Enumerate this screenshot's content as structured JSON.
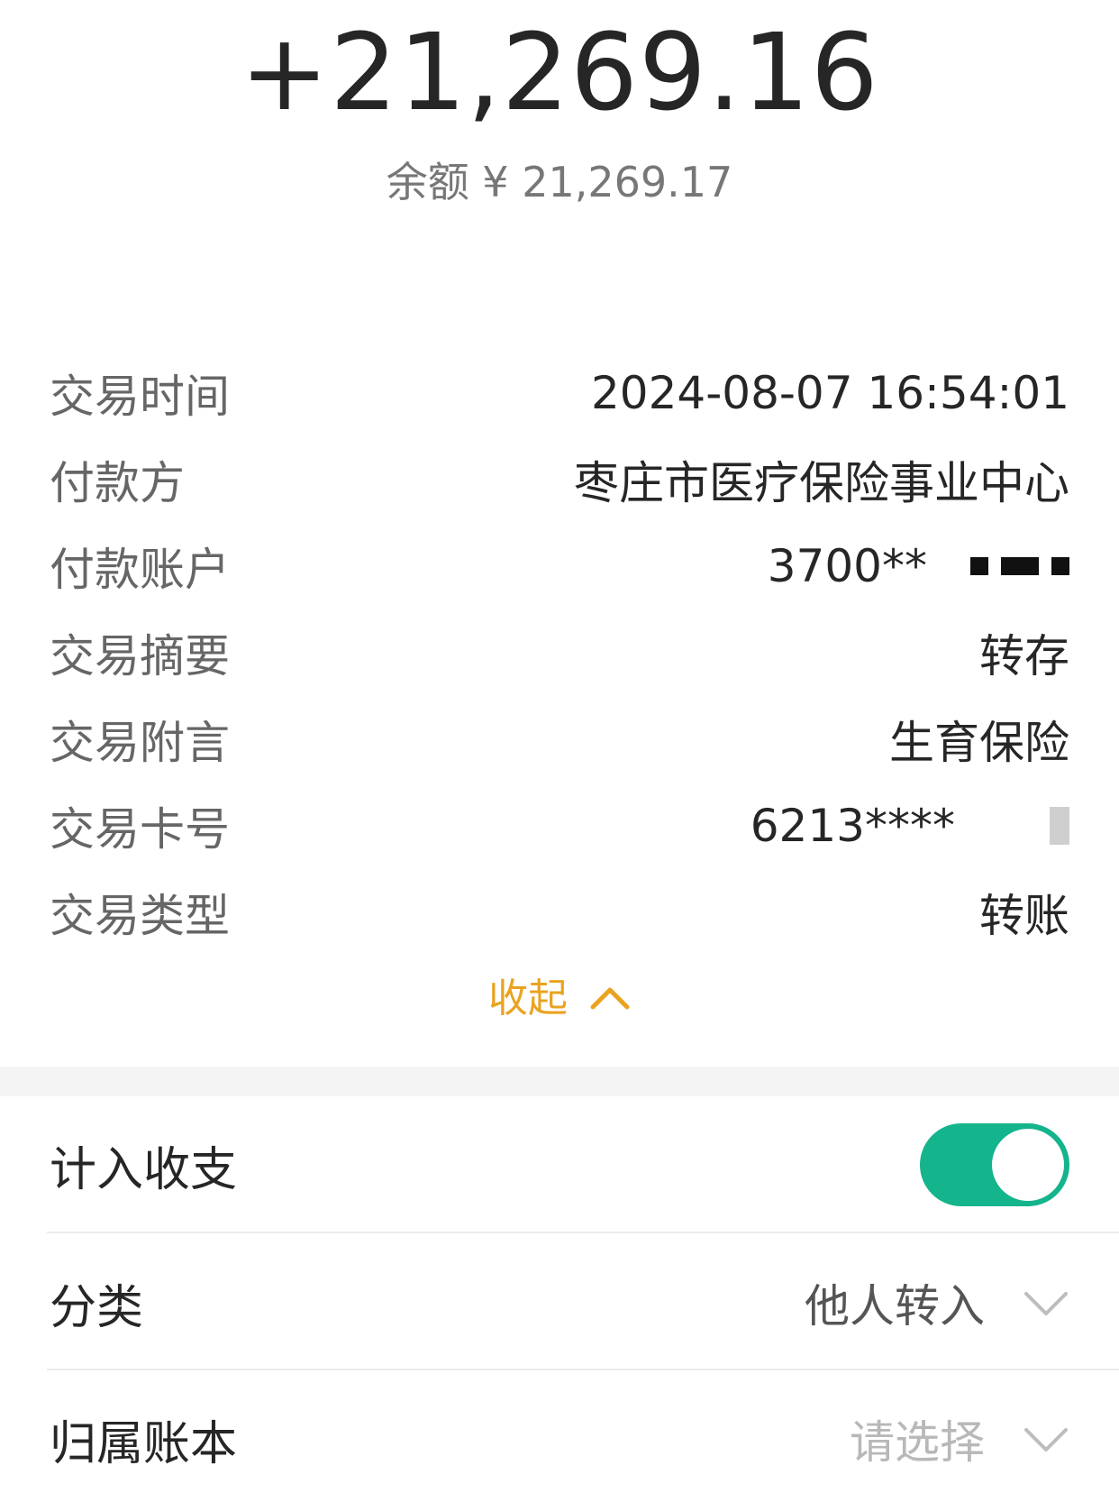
{
  "header": {
    "amount": "+21,269.16",
    "balance": "余额 ¥ 21,269.17"
  },
  "details": [
    {
      "label": "交易时间",
      "value": "2024-08-07 16:54:01"
    },
    {
      "label": "付款方",
      "value": "枣庄市医疗保险事业中心"
    },
    {
      "label": "付款账户",
      "value": "3700**"
    },
    {
      "label": "交易摘要",
      "value": "转存"
    },
    {
      "label": "交易附言",
      "value": "生育保险"
    },
    {
      "label": "交易卡号",
      "value": "6213****"
    },
    {
      "label": "交易类型",
      "value": "转账"
    }
  ],
  "collapse": {
    "label": "收起",
    "icon": "chevron-up-icon",
    "color": "#e9a320"
  },
  "settings": {
    "include_income": {
      "label": "计入收支",
      "enabled": true,
      "toggle_color": "#14b48c"
    },
    "category": {
      "label": "分类",
      "value": "他人转入",
      "icon": "chevron-down-icon"
    },
    "ledger": {
      "label": "归属账本",
      "placeholder": "请选择",
      "icon": "chevron-down-icon"
    }
  }
}
